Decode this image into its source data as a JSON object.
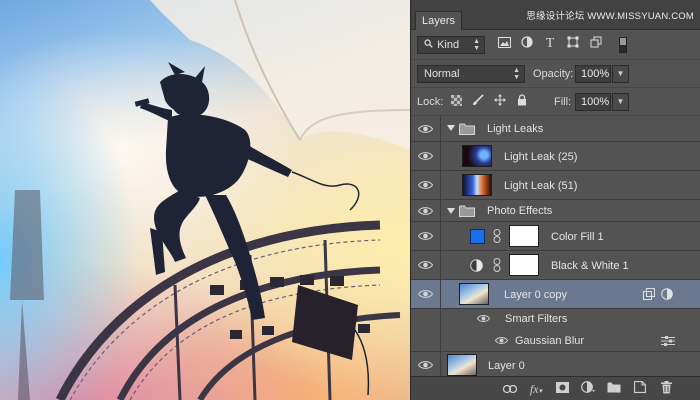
{
  "panel": {
    "tab_title": "Layers",
    "watermark": "思缘设计论坛 WWW.MISSYUAN.COM"
  },
  "filter": {
    "kind_label": "Kind",
    "icons": [
      "search-icon",
      "image-filter-icon",
      "adjustment-filter-icon",
      "type-filter-icon",
      "shape-filter-icon",
      "smart-object-filter-icon",
      "filter-toggle-icon"
    ]
  },
  "blend": {
    "mode": "Normal",
    "opacity_label": "Opacity:",
    "opacity_value": "100%"
  },
  "lock": {
    "label": "Lock:",
    "icons": [
      "lock-transparent-icon",
      "lock-paint-icon",
      "lock-move-icon",
      "lock-all-icon"
    ],
    "fill_label": "Fill:",
    "fill_value": "100%"
  },
  "layers": [
    {
      "name": "Light Leaks",
      "type": "group",
      "expanded": true
    },
    {
      "name": "Light Leak (25)",
      "type": "pixel"
    },
    {
      "name": "Light Leak (51)",
      "type": "pixel"
    },
    {
      "name": "Photo Effects",
      "type": "group",
      "expanded": true
    },
    {
      "name": "Color Fill 1",
      "type": "fill",
      "fill_color": "#1a6fe8"
    },
    {
      "name": "Black & White 1",
      "type": "adjustment"
    },
    {
      "name": "Layer 0 copy",
      "type": "smart-object",
      "selected": true
    },
    {
      "name": "Smart Filters",
      "type": "smart-filters"
    },
    {
      "name": "Gaussian Blur",
      "type": "filter"
    },
    {
      "name": "Layer 0",
      "type": "pixel"
    }
  ],
  "bottom_bar": {
    "icons": [
      "link-layers-icon",
      "fx-icon",
      "add-mask-icon",
      "new-adjustment-icon",
      "new-group-icon",
      "new-layer-icon",
      "delete-layer-icon"
    ],
    "fx_label": "fx"
  },
  "colors": {
    "panel_bg": "#535353",
    "selected_row": "#6a7990",
    "fill_color": "#1a6fe8"
  }
}
